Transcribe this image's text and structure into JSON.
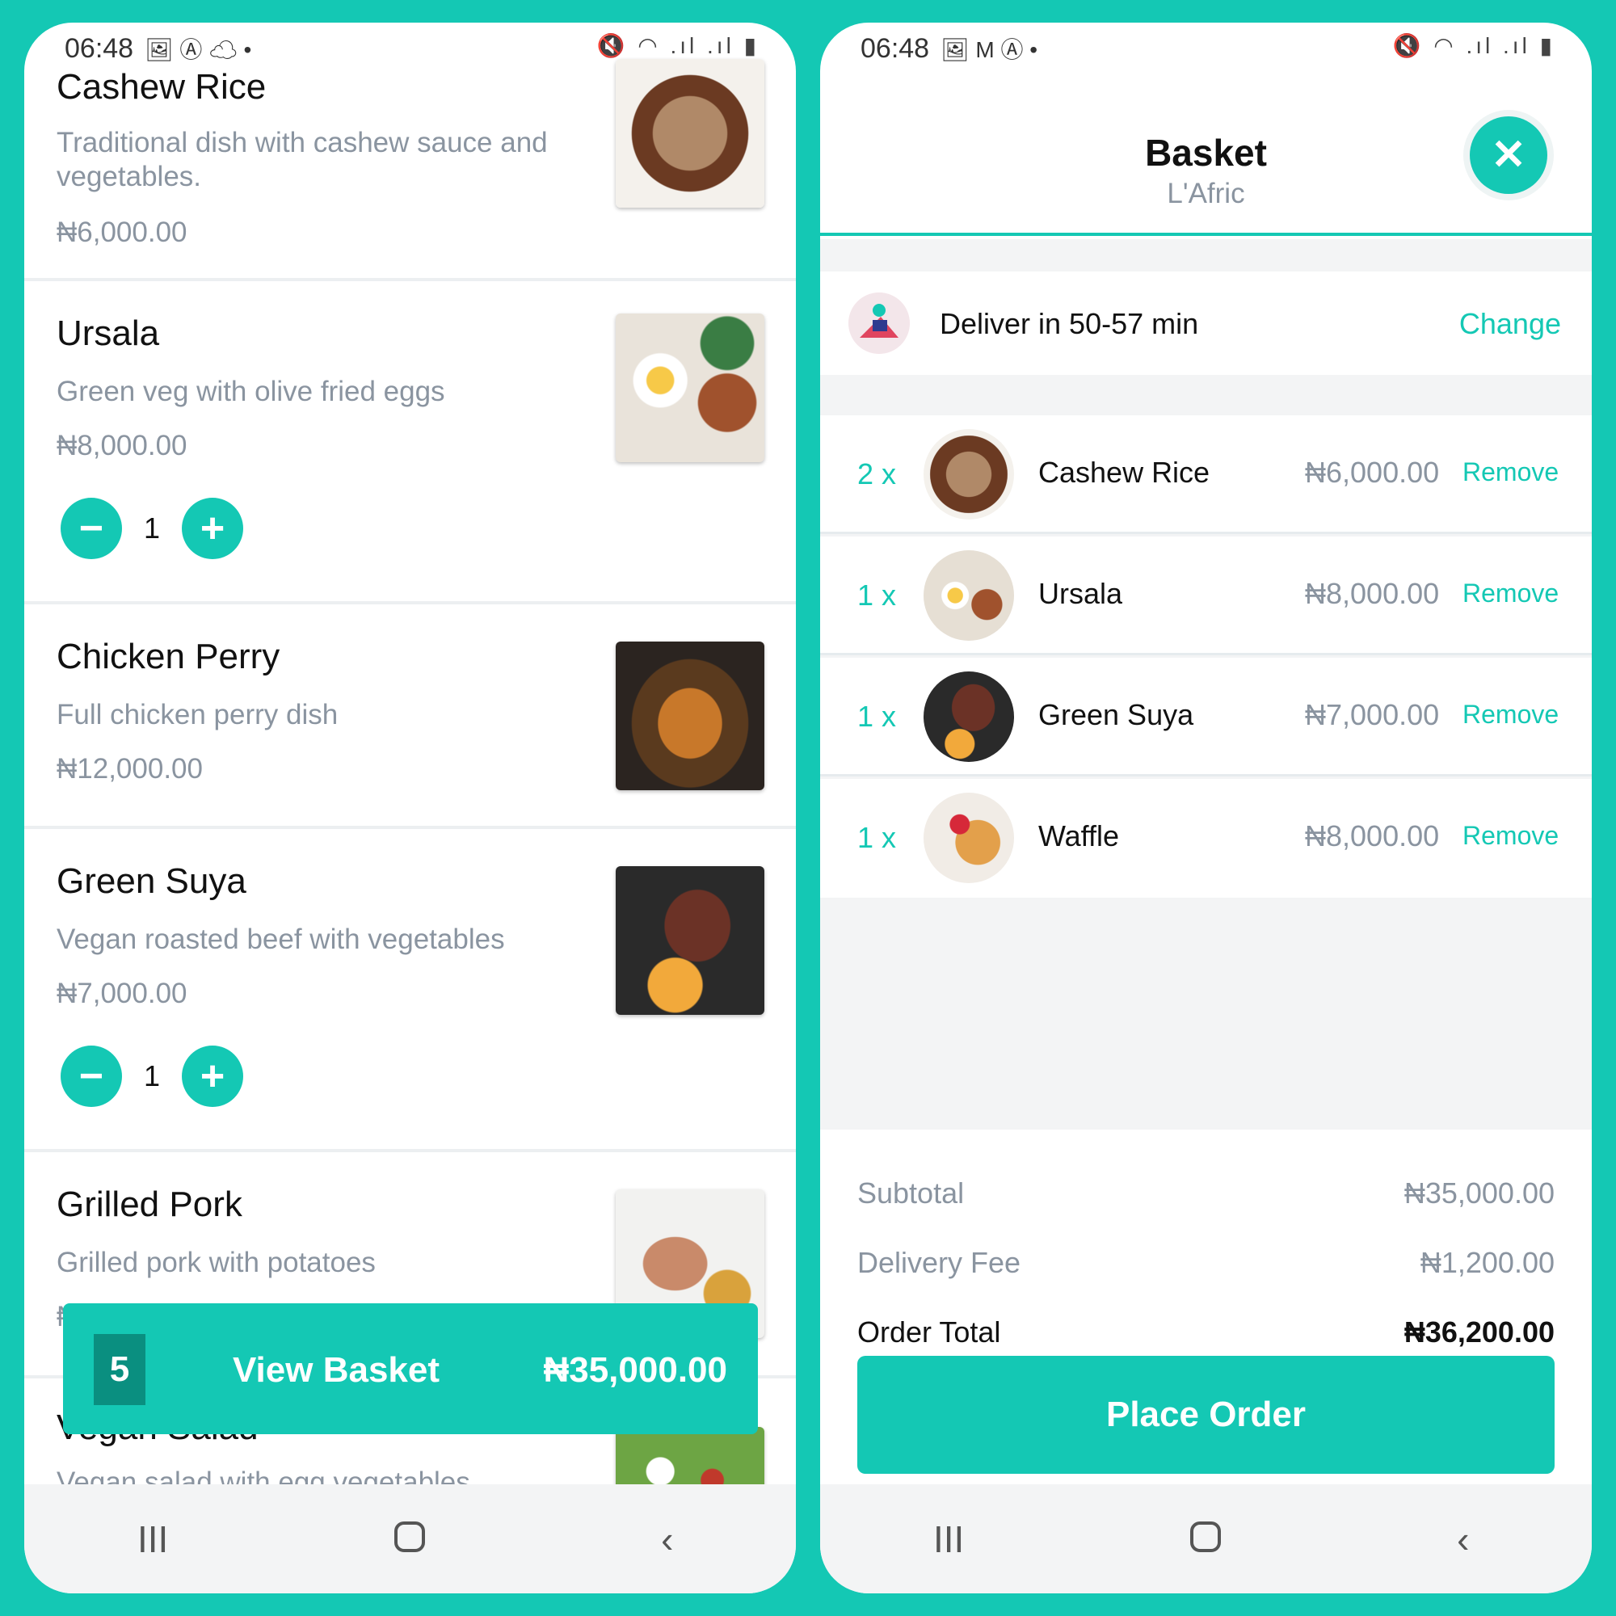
{
  "left": {
    "status": {
      "time": "06:48",
      "left_icons": "🖼 Ⓐ ☁ •",
      "right_icons": "🔇 ◠ .ıl .ıl ▮"
    },
    "menu": [
      {
        "name": "Cashew Rice",
        "desc": "Traditional dish with cashew sauce and vegetables.",
        "price": "₦6,000.00"
      },
      {
        "name": "Ursala",
        "desc": "Green veg with olive fried eggs",
        "price": "₦8,000.00",
        "qty": "1"
      },
      {
        "name": "Chicken Perry",
        "desc": "Full chicken perry dish",
        "price": "₦12,000.00"
      },
      {
        "name": "Green Suya",
        "desc": "Vegan roasted beef with vegetables",
        "price": "₦7,000.00",
        "qty": "1"
      },
      {
        "name": "Grilled Pork",
        "desc": "Grilled pork with potatoes",
        "price": "₦"
      },
      {
        "name": "Vegan Salad",
        "desc": "Vegan salad with egg vegetables"
      }
    ],
    "basket_bar": {
      "count": "5",
      "label": "View Basket",
      "total": "₦35,000.00"
    }
  },
  "right": {
    "status": {
      "time": "06:48",
      "left_icons": "🖼 M Ⓐ •",
      "right_icons": "🔇 ◠ .ıl .ıl ▮"
    },
    "header": {
      "title": "Basket",
      "subtitle": "L'Afric",
      "close": "✕"
    },
    "delivery": {
      "text": "Deliver in 50-57 min",
      "change": "Change"
    },
    "items": [
      {
        "qty": "2 x",
        "name": "Cashew Rice",
        "price": "₦6,000.00",
        "remove": "Remove"
      },
      {
        "qty": "1 x",
        "name": "Ursala",
        "price": "₦8,000.00",
        "remove": "Remove"
      },
      {
        "qty": "1 x",
        "name": "Green Suya",
        "price": "₦7,000.00",
        "remove": "Remove"
      },
      {
        "qty": "1 x",
        "name": "Waffle",
        "price": "₦8,000.00",
        "remove": "Remove"
      }
    ],
    "summary": {
      "subtotal_label": "Subtotal",
      "subtotal": "₦35,000.00",
      "fee_label": "Delivery Fee",
      "fee": "₦1,200.00",
      "total_label": "Order Total",
      "total": "₦36,200.00"
    },
    "place_order": "Place Order"
  },
  "nav": {
    "recents": "III",
    "back": "‹"
  },
  "colors": {
    "accent": "#14c8b4",
    "accent_dark": "#0a8f80",
    "muted_text": "#8a94a0",
    "panel_gray": "#f3f4f5"
  },
  "stepper": {
    "minus": "−",
    "plus": "+"
  }
}
